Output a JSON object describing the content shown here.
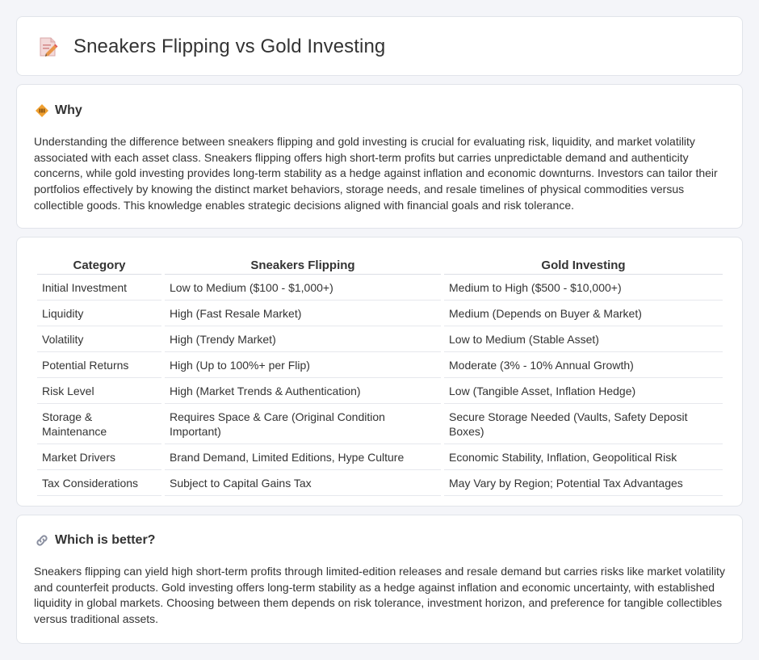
{
  "title": "Sneakers Flipping vs Gold Investing",
  "why": {
    "heading": "Why",
    "text": "Understanding the difference between sneakers flipping and gold investing is crucial for evaluating risk, liquidity, and market volatility associated with each asset class. Sneakers flipping offers high short-term profits but carries unpredictable demand and authenticity concerns, while gold investing provides long-term stability as a hedge against inflation and economic downturns. Investors can tailor their portfolios effectively by knowing the distinct market behaviors, storage needs, and resale timelines of physical commodities versus collectible goods. This knowledge enables strategic decisions aligned with financial goals and risk tolerance."
  },
  "table": {
    "headers": [
      "Category",
      "Sneakers Flipping",
      "Gold Investing"
    ],
    "rows": [
      [
        "Initial Investment",
        "Low to Medium ($100 - $1,000+)",
        "Medium to High ($500 - $10,000+)"
      ],
      [
        "Liquidity",
        "High (Fast Resale Market)",
        "Medium (Depends on Buyer & Market)"
      ],
      [
        "Volatility",
        "High (Trendy Market)",
        "Low to Medium (Stable Asset)"
      ],
      [
        "Potential Returns",
        "High (Up to 100%+ per Flip)",
        "Moderate (3% - 10% Annual Growth)"
      ],
      [
        "Risk Level",
        "High (Market Trends & Authentication)",
        "Low (Tangible Asset, Inflation Hedge)"
      ],
      [
        "Storage & Maintenance",
        "Requires Space & Care (Original Condition Important)",
        "Secure Storage Needed (Vaults, Safety Deposit Boxes)"
      ],
      [
        "Market Drivers",
        "Brand Demand, Limited Editions, Hype Culture",
        "Economic Stability, Inflation, Geopolitical Risk"
      ],
      [
        "Tax Considerations",
        "Subject to Capital Gains Tax",
        "May Vary by Region; Potential Tax Advantages"
      ]
    ]
  },
  "better": {
    "heading": "Which is better?",
    "text": "Sneakers flipping can yield high short-term profits through limited-edition releases and resale demand but carries risks like market volatility and counterfeit products. Gold investing offers long-term stability as a hedge against inflation and economic uncertainty, with established liquidity in global markets. Choosing between them depends on risk tolerance, investment horizon, and preference for tangible collectibles versus traditional assets."
  },
  "icons": {
    "title": "document-pencil-icon",
    "why": "diamond-sign-icon",
    "better": "link-icon"
  },
  "colors": {
    "accent_orange": "#f0a030",
    "icon_red": "#e05a5a",
    "background": "#f4f5f9"
  }
}
